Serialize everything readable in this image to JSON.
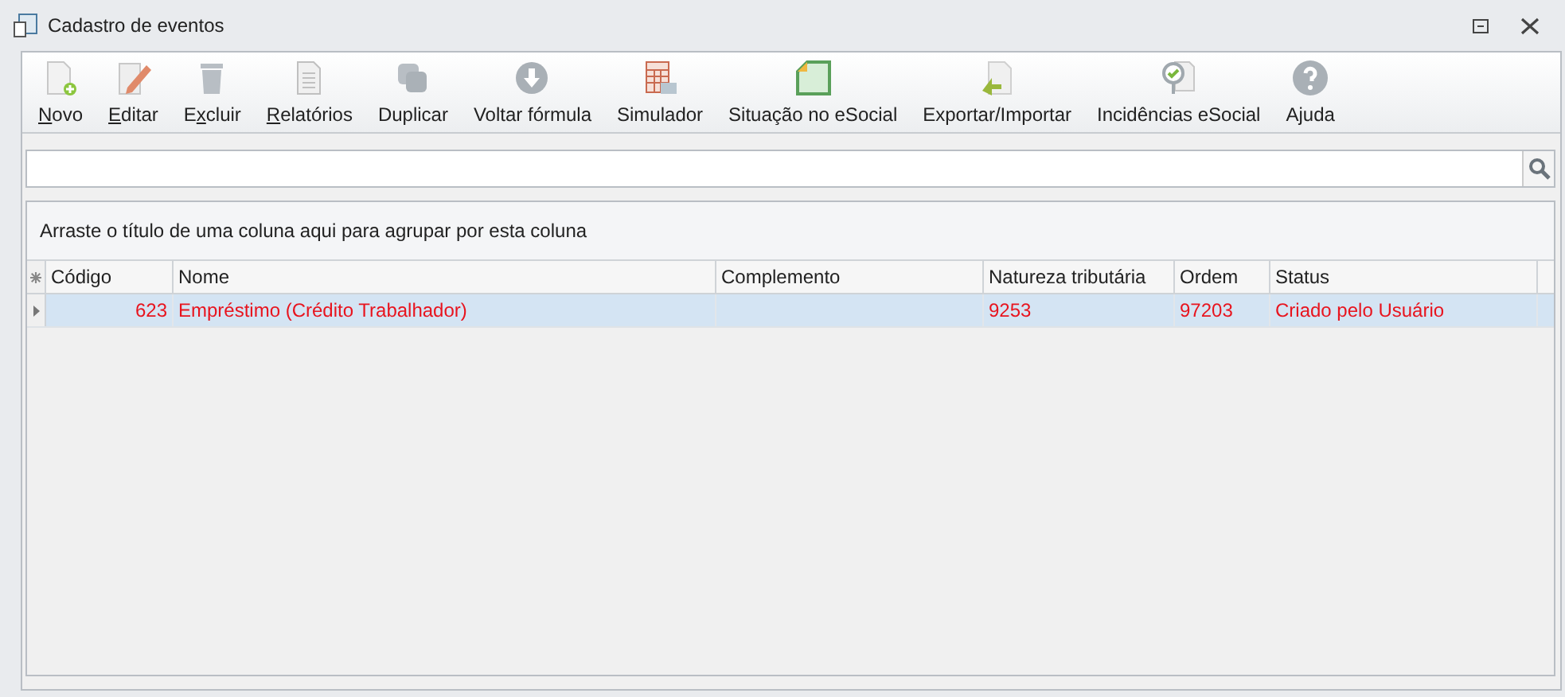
{
  "window": {
    "title": "Cadastro de eventos"
  },
  "toolbar": [
    {
      "label": "Novo",
      "disabled": false
    },
    {
      "label": "Editar",
      "disabled": false
    },
    {
      "label": "Excluir",
      "disabled": false
    },
    {
      "label": "Relatórios",
      "disabled": false
    },
    {
      "label": "Duplicar",
      "disabled": false
    },
    {
      "label": "Voltar fórmula",
      "disabled": false
    },
    {
      "label": "Simulador",
      "disabled": false
    },
    {
      "label": "Situação no eSocial",
      "disabled": false
    },
    {
      "label": "Exportar/Importar",
      "disabled": false
    },
    {
      "label": "Incidências eSocial",
      "disabled": false
    },
    {
      "label": "Ajuda",
      "disabled": false
    }
  ],
  "grid": {
    "group_hint": "Arraste o título de uma coluna aqui para agrupar por esta coluna",
    "columns": [
      "Código",
      "Nome",
      "Complemento",
      "Natureza tributária",
      "Ordem",
      "Status"
    ],
    "rows": [
      {
        "selected": true,
        "cells": [
          "623",
          "Empréstimo (Crédito Trabalhador)",
          "",
          "9253",
          "97203",
          "Criado pelo Usuário"
        ]
      }
    ]
  }
}
